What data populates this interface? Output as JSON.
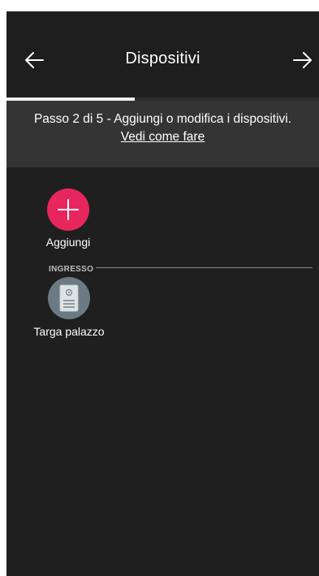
{
  "header": {
    "title": "Dispositivi",
    "back_icon": "arrow-left-icon",
    "next_icon": "arrow-right-icon"
  },
  "progress": {
    "step": 2,
    "total": 5,
    "fraction": 0.41
  },
  "step_info": {
    "text": "Passo 2 di 5 - Aggiungi o modifica i dispositivi.",
    "link": "Vedi come fare"
  },
  "add": {
    "label": "Aggiungi",
    "icon": "plus-icon",
    "color": "#e8265e"
  },
  "sections": [
    {
      "label": "INGRESSO",
      "devices": [
        {
          "label": "Targa palazzo",
          "icon": "door-panel-icon"
        }
      ]
    }
  ],
  "colors": {
    "background": "#1f1f1f",
    "step_bar": "#343434",
    "accent": "#e8265e",
    "device": "#6b7a83"
  }
}
